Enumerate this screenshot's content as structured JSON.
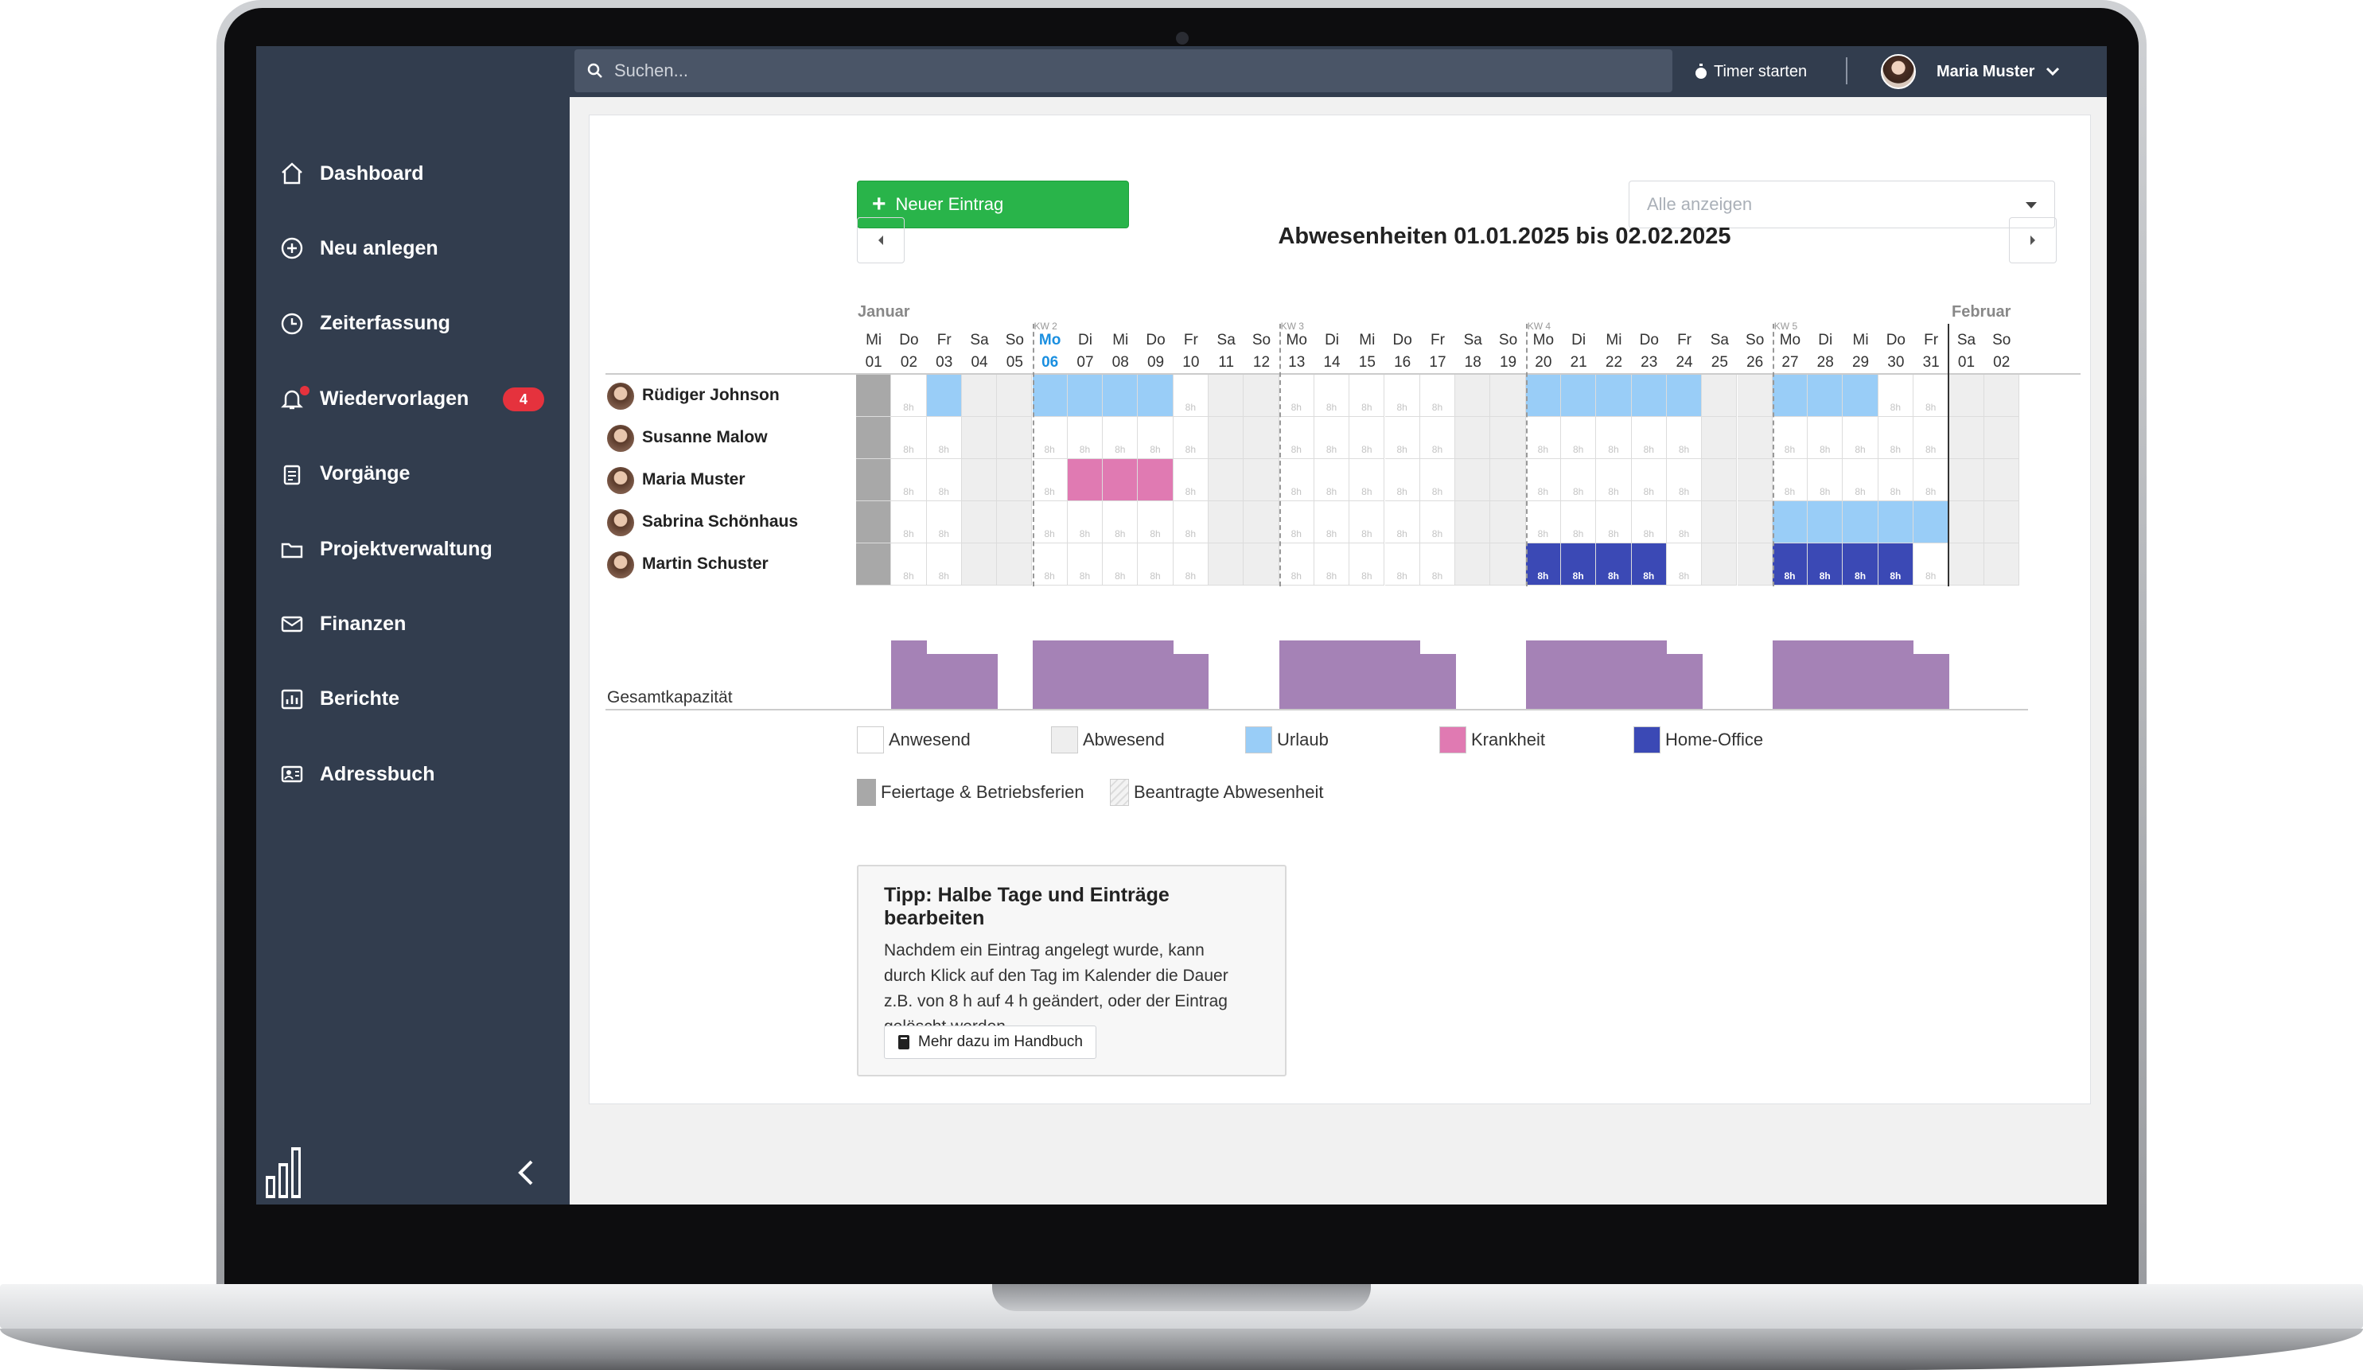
{
  "search": {
    "placeholder": "Suchen..."
  },
  "topbar": {
    "timer_label": "Timer starten",
    "user_name": "Maria Muster"
  },
  "sidebar": {
    "items": [
      {
        "label": "Dashboard",
        "icon": "home-icon"
      },
      {
        "label": "Neu anlegen",
        "icon": "plus-circle-icon"
      },
      {
        "label": "Zeiterfassung",
        "icon": "clock-icon"
      },
      {
        "label": "Wiedervorlagen",
        "icon": "bell-icon",
        "badge": "4"
      },
      {
        "label": "Vorgänge",
        "icon": "clipboard-icon"
      },
      {
        "label": "Projektverwaltung",
        "icon": "folder-icon"
      },
      {
        "label": "Finanzen",
        "icon": "mail-icon"
      },
      {
        "label": "Berichte",
        "icon": "chart-icon"
      },
      {
        "label": "Adressbuch",
        "icon": "contact-card-icon"
      }
    ]
  },
  "toolbar": {
    "new_entry": "Neuer Eintrag",
    "filter_value": "Alle anzeigen"
  },
  "calendar": {
    "title": "Abwesenheiten 01.01.2025 bis 02.02.2025",
    "month_start": "Januar",
    "month_end": "Februar",
    "week_labels": [
      {
        "day_index": 5,
        "label": "KW 2"
      },
      {
        "day_index": 12,
        "label": "KW 3"
      },
      {
        "day_index": 19,
        "label": "KW 4"
      },
      {
        "day_index": 26,
        "label": "KW 5"
      }
    ],
    "days": [
      {
        "wd": "Mi",
        "d": "01"
      },
      {
        "wd": "Do",
        "d": "02"
      },
      {
        "wd": "Fr",
        "d": "03"
      },
      {
        "wd": "Sa",
        "d": "04"
      },
      {
        "wd": "So",
        "d": "05"
      },
      {
        "wd": "Mo",
        "d": "06"
      },
      {
        "wd": "Di",
        "d": "07"
      },
      {
        "wd": "Mi",
        "d": "08"
      },
      {
        "wd": "Do",
        "d": "09"
      },
      {
        "wd": "Fr",
        "d": "10"
      },
      {
        "wd": "Sa",
        "d": "11"
      },
      {
        "wd": "So",
        "d": "12"
      },
      {
        "wd": "Mo",
        "d": "13"
      },
      {
        "wd": "Di",
        "d": "14"
      },
      {
        "wd": "Mi",
        "d": "15"
      },
      {
        "wd": "Do",
        "d": "16"
      },
      {
        "wd": "Fr",
        "d": "17"
      },
      {
        "wd": "Sa",
        "d": "18"
      },
      {
        "wd": "So",
        "d": "19"
      },
      {
        "wd": "Mo",
        "d": "20"
      },
      {
        "wd": "Di",
        "d": "21"
      },
      {
        "wd": "Mi",
        "d": "22"
      },
      {
        "wd": "Do",
        "d": "23"
      },
      {
        "wd": "Fr",
        "d": "24"
      },
      {
        "wd": "Sa",
        "d": "25"
      },
      {
        "wd": "So",
        "d": "26"
      },
      {
        "wd": "Mo",
        "d": "27"
      },
      {
        "wd": "Di",
        "d": "28"
      },
      {
        "wd": "Mi",
        "d": "29"
      },
      {
        "wd": "Do",
        "d": "30"
      },
      {
        "wd": "Fr",
        "d": "31"
      },
      {
        "wd": "Sa",
        "d": "01"
      },
      {
        "wd": "So",
        "d": "02"
      }
    ],
    "today_index": 5,
    "hours_label": "8h",
    "people": [
      {
        "name": "Rüdiger Johnson",
        "cells": "HAUAA UUUUAAA AAAAAAA UUUUUAA UUUAAAA"
      },
      {
        "name": "Susanne Malow",
        "cells": "HAAAA AAAAAAA AAAAAAA AAAAAAA AAAAAAA"
      },
      {
        "name": "Maria Muster",
        "cells": "HAAAA AKKKAAA AAAAAAA AAAAAAA AAAAAAA"
      },
      {
        "name": "Sabrina Schönhaus",
        "cells": "HAAAA AAAAAAA AAAAAAA AAAAAAA UUUUUAA"
      },
      {
        "name": "Martin Schuster",
        "cells": "HAAAA AAAAAAA AAAAAAA OOOOAAA OOOOAAA"
      }
    ],
    "capacity_label": "Gesamtkapazität"
  },
  "legend": [
    {
      "label": "Anwesend",
      "color": "#ffffff"
    },
    {
      "label": "Abwesend",
      "color": "#eeeeee"
    },
    {
      "label": "Urlaub",
      "color": "#99cdf7"
    },
    {
      "label": "Krankheit",
      "color": "#e07ab2"
    },
    {
      "label": "Home-Office",
      "color": "#3b49b5"
    },
    {
      "label": "Feiertage & Betriebsferien",
      "color": "#a8a8a8"
    },
    {
      "label": "Beantragte Abwesenheit",
      "color": "#f3f3f3"
    }
  ],
  "tip": {
    "title": "Tipp: Halbe Tage und Einträge bearbeiten",
    "lines": [
      "Nachdem ein Eintrag angelegt wurde, kann",
      "durch Klick auf den Tag im Kalender die Dauer",
      "z.B. von 8 h auf 4 h geändert, oder der Eintrag",
      "gelöscht werden."
    ],
    "button": "Mehr dazu im Handbuch"
  },
  "colors": {
    "sidebar": "#323d4e",
    "accent_green": "#29b44a",
    "today_blue": "#1a8fe0",
    "badge_red": "#e5323d",
    "capacity": "#a582b6"
  }
}
